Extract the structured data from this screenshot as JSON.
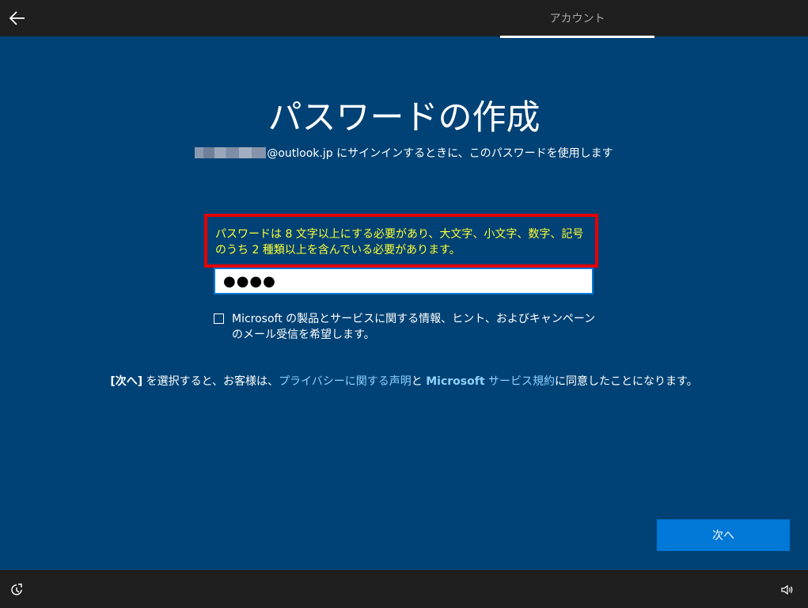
{
  "header": {
    "back_icon": "back-arrow-icon",
    "tab_label": "アカウント"
  },
  "main": {
    "title": "パスワードの作成",
    "subtitle_email_suffix": "@outlook.jp",
    "subtitle_text": " にサインインするときに、このパスワードを使用します",
    "error_message": "パスワードは 8 文字以上にする必要があり、大文字、小文字、数字、記号のうち 2 種類以上を含んでいる必要があります。",
    "password_value": "●●●●",
    "checkbox_label": "Microsoft の製品とサービスに関する情報、ヒント、およびキャンペーンのメール受信を希望します。",
    "checkbox_checked": false
  },
  "legal": {
    "next_ref": "[次へ]",
    "text1": " を選択すると、お客様は、",
    "privacy_link": "プライバシーに関する声明",
    "text2": "と ",
    "terms_brand": "Microsoft",
    "terms_link": " サービス規約",
    "text3": "に同意したことになります。"
  },
  "buttons": {
    "next_label": "次へ"
  },
  "footer": {
    "ease_icon": "ease-of-access-icon",
    "volume_icon": "volume-icon"
  },
  "colors": {
    "background": "#004275",
    "bar": "#1f1f1f",
    "accent": "#0078d7",
    "error_text": "#ffff33",
    "error_border": "#e50000",
    "link": "#8fd0ff"
  }
}
